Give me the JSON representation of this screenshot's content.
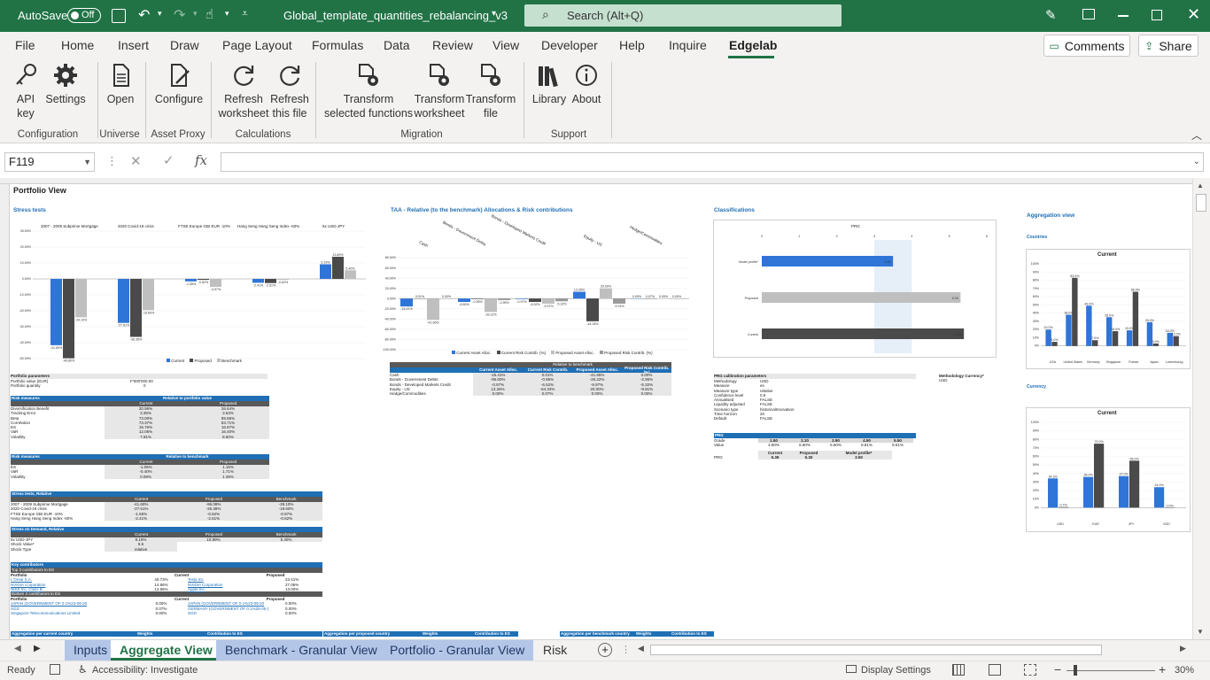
{
  "titlebar": {
    "autosave_label": "AutoSave",
    "autosave_state": "Off",
    "filename": "Global_template_quantities_rebalancing_v3",
    "search_placeholder": "Search (Alt+Q)"
  },
  "ribbon_tabs": [
    "File",
    "Home",
    "Insert",
    "Draw",
    "Page Layout",
    "Formulas",
    "Data",
    "Review",
    "View",
    "Developer",
    "Help",
    "Inquire",
    "Edgelab"
  ],
  "active_tab": "Edgelab",
  "comments_label": "Comments",
  "share_label": "Share",
  "ribbon": {
    "groups": [
      {
        "label": "Configuration",
        "buttons": [
          {
            "l1": "API",
            "l2": "key",
            "icon": "key-icon"
          },
          {
            "l1": "Settings",
            "l2": "",
            "icon": "gear-icon"
          }
        ]
      },
      {
        "label": "Universe",
        "buttons": [
          {
            "l1": "Open",
            "l2": "",
            "icon": "document-icon"
          }
        ]
      },
      {
        "label": "Asset Proxy",
        "buttons": [
          {
            "l1": "Configure",
            "l2": "",
            "icon": "configure-icon"
          }
        ]
      },
      {
        "label": "Calculations",
        "buttons": [
          {
            "l1": "Refresh",
            "l2": "worksheet",
            "icon": "refresh-icon"
          },
          {
            "l1": "Refresh",
            "l2": "this file",
            "icon": "refresh-icon"
          }
        ]
      },
      {
        "label": "Migration",
        "buttons": [
          {
            "l1": "Transform",
            "l2": "selected functions",
            "icon": "transform-icon"
          },
          {
            "l1": "Transform",
            "l2": "worksheet",
            "icon": "transform-icon"
          },
          {
            "l1": "Transform",
            "l2": "file",
            "icon": "transform-icon"
          }
        ]
      },
      {
        "label": "Support",
        "buttons": [
          {
            "l1": "Library",
            "l2": "",
            "icon": "library-icon"
          },
          {
            "l1": "About",
            "l2": "",
            "icon": "info-icon"
          }
        ]
      }
    ]
  },
  "namebox": "F119",
  "formula": "",
  "sheet": {
    "title": "Portfolio View",
    "stress_title": "Stress tests",
    "stress_categories": [
      "2007 - 2009 Subprime Mortgage",
      "2020 Covid-19 crisis",
      "FTSE Europe GBI EUR -10%",
      "Hang Seng Hang Seng Index -50%",
      "5x USD-JPY"
    ],
    "taa_title": "TAA - Relative (to the benchmark) Allocations & Risk contributions",
    "taa_categories": [
      "Cash",
      "Bonds - Government Debts",
      "Bonds - Developed Markets Credit",
      "Equity - US",
      "Hedge/Commodities"
    ],
    "classif_title": "Classifications",
    "prg_label": "PRG",
    "prg_rows": [
      "Model profile*",
      "Proposed",
      "Current"
    ],
    "aggregation_title": "Aggregation view",
    "countries_label": "Countries",
    "currency_label": "Currency",
    "current_label": "Current",
    "legend_stress": [
      "Current",
      "Proposed",
      "Benchmark"
    ],
    "legend_taa": [
      "Current Asset Alloc.",
      "Current Risk Contrib. (%)",
      "Proposed Asset Alloc.",
      "Proposed Risk Contrib. (%)"
    ],
    "portfolio_params": {
      "title": "Portfolio parameters",
      "rows": [
        [
          "Portfolio value (EUR)",
          "F'000'000.00"
        ],
        [
          "Portfolio quantity",
          "0"
        ]
      ]
    },
    "risk_measures": {
      "title": "Risk measures",
      "sub": "Relative to portfolio value",
      "cols": [
        "Current",
        "Proposed"
      ],
      "rows": [
        [
          "Diversification Benefit",
          "20.96%",
          "26.64%"
        ],
        [
          "Tracking Error",
          "3.35%",
          "3.63%"
        ],
        [
          "Beta",
          "73.00%",
          "89.66%"
        ],
        [
          "Correlation",
          "73.37%",
          "83.71%"
        ],
        [
          "ES",
          "16.76%",
          "16.67%"
        ],
        [
          "VaR",
          "12.05%",
          "16.40%"
        ],
        [
          "Volatility",
          "7.91%",
          "8.60%"
        ]
      ]
    },
    "risk_bench": {
      "title": "Risk measures",
      "sub": "Relative to benchmark",
      "cols": [
        "Current",
        "Proposed"
      ],
      "rows": [
        [
          "ES",
          "-1.06%",
          "1.15%"
        ],
        [
          "VaR",
          "-0.40%",
          "1.71%"
        ],
        [
          "Volatility",
          "0.09%",
          "1.38%"
        ]
      ]
    },
    "stress_rel": {
      "title": "Stress tests, Relative",
      "cols": [
        "Current",
        "Proposed",
        "Benchmark"
      ],
      "rows": [
        [
          "2007 - 2009 Subprime Mortgage",
          "-41.60%",
          "-96.08%",
          "-28.10%"
        ],
        [
          "2020 Covid-19 crisis",
          "-27.61%",
          "-26.38%",
          "-19.60%"
        ],
        [
          "FTSE Europe GBI EUR -10%",
          "-1.55%",
          "-0.62%",
          "-0.97%"
        ],
        [
          "Hang Seng Hang Seng Index -50%",
          "-2.41%",
          "-2.61%",
          "-0.62%"
        ]
      ]
    },
    "stress_demand": {
      "title": "Stress on Demand, Relative",
      "cols": [
        "Current",
        "Proposed",
        "Benchmark"
      ],
      "rows": [
        [
          "5x USD-JPY",
          "9.19%",
          "10.89%",
          "5.40%"
        ],
        [
          "Shock Value*",
          "9.5",
          "",
          ""
        ],
        [
          "Shock Type",
          "relative",
          "",
          ""
        ]
      ]
    },
    "key_contrib": {
      "title": "Key contributors",
      "sub": "Top 3 contributors to ES",
      "cols": [
        "Portfolio",
        "Current",
        "Proposed"
      ],
      "rows": [
        [
          "L'Oreal S.A.",
          "40.73%",
          "Tesla Inc",
          "23.41%"
        ],
        [
          "NVIDIA Corporation",
          "14.66%",
          "NVIDIA Corporation",
          "27.06%"
        ],
        [
          "NIKE Inc. Class B",
          "13.95%",
          "Apple Inc.",
          "13.00%"
        ]
      ],
      "sub2": "Bottom 3 contributors to ES",
      "rows2": [
        [
          "JAPAN (GOVERNMENT OF 0.1%23-09-20",
          "0.00%",
          "JAPAN (GOVERNMENT OF 0.1%23-09-20",
          "0.00%"
        ],
        [
          "SGD",
          "0.07%",
          "GERMANY (GOVERNMENT OF 0.1%26-05-)",
          "0.00%"
        ],
        [
          "Singapore Telecommunications Limited",
          "0.00%",
          "SGD",
          "0.00%"
        ]
      ]
    },
    "taa_table": {
      "title": "Relative to benchmark",
      "cols": [
        "Current Asset Alloc.",
        "Current Risk Contrib.",
        "Proposed Asset Alloc.",
        "Proposed Risk Contrib. (%)"
      ],
      "rows": [
        [
          "Cash",
          "-15.41%",
          "0.01%",
          "-41.65%",
          "0.00%"
        ],
        [
          "Bonds - Government Debts",
          "-96.60%",
          "-0.95%",
          "-26.22%",
          "-2.95%"
        ],
        [
          "Bonds - Developed Markets Credit",
          "-0.97%",
          "-6.52%",
          "-9.97%",
          "-5.32%"
        ],
        [
          "Equity - US",
          "13.26%",
          "-64.34%",
          "20.00%",
          "-9.91%"
        ],
        [
          "Hedge/Commodities",
          "0.00%",
          "0.07%",
          "0.00%",
          "0.00%"
        ]
      ]
    },
    "prg_params": {
      "title": "PRG calibration parameters",
      "rows": [
        [
          "Methodology",
          "USD"
        ],
        [
          "Measure",
          "es"
        ],
        [
          "Measure type",
          "relative"
        ],
        [
          "Confidence level",
          "0.9"
        ],
        [
          "Annualised",
          "FALSE"
        ],
        [
          "Liquidity adjusted",
          "FALSE"
        ],
        [
          "Scenario type",
          "historicalInnovation"
        ],
        [
          "Time horizon",
          "20"
        ],
        [
          "Default",
          "FALSE"
        ]
      ]
    },
    "methodology_currency": {
      "label": "Methodology Currency*",
      "value": "USD"
    },
    "prg_table": {
      "title": "PRG",
      "grades": [
        "1.50",
        "2.10",
        "2.90",
        "4.50",
        "5.50"
      ],
      "values": [
        "4.90%",
        "6.90%",
        "6.60%",
        "8.81%",
        "8.61%"
      ],
      "cols": [
        "Current",
        "Proposed",
        "Model profile*"
      ],
      "vals": [
        "5.39",
        "5.30",
        "3.50"
      ],
      "row_label": "PRG"
    },
    "agg_row": [
      "Aggregation per current country",
      "Weights",
      "Contribution to ES",
      "Aggregation per proposed country",
      "Weights",
      "Contribution to ES",
      "Aggregation per benchmark country",
      "Weights",
      "Contribution to ES"
    ]
  },
  "chart_data": [
    {
      "type": "bar",
      "title": "Stress tests",
      "categories": [
        "2007 - 2009 Subprime Mortgage",
        "2020 Covid-19 crisis",
        "FTSE Europe GBI EUR -10%",
        "Hang Seng Hang Seng Index -50%",
        "5x USD-JPY"
      ],
      "series": [
        {
          "name": "Current",
          "values": [
            -41.6,
            -27.61,
            -1.55,
            -2.41,
            9.19
          ]
        },
        {
          "name": "Proposed",
          "values": [
            -49.8,
            -36.38,
            -0.62,
            -2.61,
            13.89
          ]
        },
        {
          "name": "Benchmark",
          "values": [
            -24.1,
            -19.6,
            -4.97,
            -0.62,
            5.4
          ]
        }
      ],
      "ylim": [
        -50,
        30
      ]
    },
    {
      "type": "bar",
      "title": "TAA - Relative (to the benchmark) Allocations & Risk contributions",
      "categories": [
        "Cash",
        "Bonds - Government Debts",
        "Bonds - Developed Markets Credit",
        "Equity - US",
        "Hedge/Commodities"
      ],
      "series": [
        {
          "name": "Current Asset Alloc.",
          "values": [
            -15.41,
            -6.6,
            -0.97,
            13.26,
            0
          ]
        },
        {
          "name": "Current Risk Contrib. (%)",
          "values": [
            0.01,
            -0.95,
            -6.52,
            -44.34,
            0.07
          ]
        },
        {
          "name": "Proposed Asset Alloc.",
          "values": [
            -41.65,
            -26.22,
            -9.97,
            20,
            0
          ]
        },
        {
          "name": "Proposed Risk Contrib. (%)",
          "values": [
            0,
            -2.95,
            -5.32,
            -9.91,
            0
          ]
        }
      ],
      "ylim": [
        -100,
        80
      ]
    },
    {
      "type": "bar",
      "title": "PRG",
      "categories": [
        "Model profile*",
        "Proposed",
        "Current"
      ],
      "values": [
        3.5,
        5.3,
        5.39
      ],
      "xlim": [
        0,
        6
      ]
    },
    {
      "type": "bar",
      "title": "Current",
      "categories": [
        "USA",
        "United States",
        "Germany",
        "Singapore",
        "France",
        "Japan",
        "Luxembourg"
      ],
      "series": [
        {
          "name": "Current",
          "values": [
            20.0,
            38.0,
            49.0,
            35.0,
            19.0,
            29.0,
            16.0
          ]
        },
        {
          "name": "Proposed",
          "values": [
            5.0,
            83.0,
            7.0,
            18.0,
            66.0,
            3.0,
            12.0
          ]
        }
      ],
      "ylim": [
        -10,
        100
      ]
    },
    {
      "type": "bar",
      "title": "Current",
      "categories": [
        "USD",
        "EUR",
        "JPY",
        "SGD"
      ],
      "series": [
        {
          "name": "Current",
          "values": [
            34.3,
            36.0,
            37.0,
            24.0
          ]
        },
        {
          "name": "Proposed",
          "values": [
            0.7,
            75.0,
            55.0,
            0
          ]
        }
      ],
      "ylim": [
        -10,
        100
      ]
    }
  ],
  "sheet_tabs": [
    "Inputs",
    "Aggregate View",
    "Benchmark - Granular View",
    "Portfolio - Granular View",
    "Risk Fa..."
  ],
  "active_sheet": "Aggregate View",
  "status": {
    "ready": "Ready",
    "accessibility": "Accessibility: Investigate",
    "display": "Display Settings",
    "zoom": "30%"
  },
  "colors": {
    "excel_green": "#217346",
    "blue": "#1f6fb5",
    "bar_blue": "#2f75d8",
    "dark": "#4a4a4a",
    "light": "#bfbfbf"
  }
}
